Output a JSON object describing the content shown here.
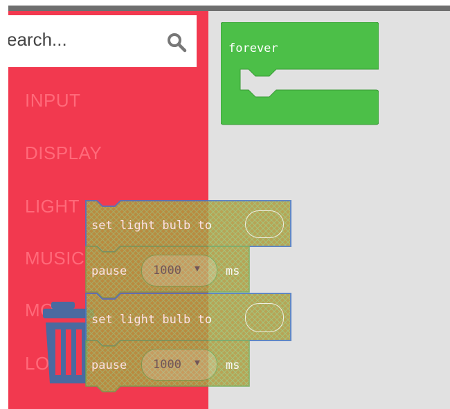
{
  "search": {
    "placeholder_visible": "earch..."
  },
  "categories": [
    {
      "label": "INPUT"
    },
    {
      "label": "DISPLAY"
    },
    {
      "label": "LIGHT"
    },
    {
      "label": "MUSIC"
    },
    {
      "label": "MOT"
    },
    {
      "label": "LO"
    }
  ],
  "workspace": {
    "forever_block": {
      "label": "forever",
      "color": "#4cbf48"
    }
  },
  "dragged_blocks": [
    {
      "text": "set light bulb to"
    },
    {
      "text": "pause",
      "value": "1000",
      "unit": "ms"
    },
    {
      "text": "set light bulb to"
    },
    {
      "text": "pause",
      "value": "1000",
      "unit": "ms"
    }
  ],
  "colors": {
    "sidebar": "#f2394f",
    "workspace": "#e1e1e1",
    "topbar": "#6f6f6f",
    "block_olive": "#b0a040",
    "trash": "#4a6aa0"
  }
}
